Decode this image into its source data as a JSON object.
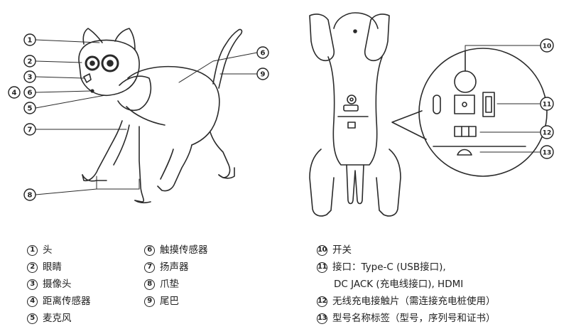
{
  "callouts": [
    "1",
    "2",
    "3",
    "4",
    "6",
    "5",
    "7",
    "8",
    "6",
    "9",
    "10",
    "11",
    "12",
    "13"
  ],
  "legend": [
    {
      "num": "1",
      "label": "头"
    },
    {
      "num": "2",
      "label": "眼睛"
    },
    {
      "num": "3",
      "label": "摄像头"
    },
    {
      "num": "4",
      "label": "距离传感器"
    },
    {
      "num": "5",
      "label": "麦克风"
    },
    {
      "num": "6",
      "label": "触摸传感器"
    },
    {
      "num": "7",
      "label": "扬声器"
    },
    {
      "num": "8",
      "label": "爪垫"
    },
    {
      "num": "9",
      "label": "尾巴"
    },
    {
      "num": "10",
      "label": "开关"
    },
    {
      "num": "11",
      "label": "接口：Type-C (USB接口),",
      "label2": "DC JACK (充电线接口), HDMI"
    },
    {
      "num": "12",
      "label": "无线充电接触片（需连接充电桩使用）"
    },
    {
      "num": "13",
      "label": "型号名称标签（型号，序列号和证书）"
    }
  ]
}
